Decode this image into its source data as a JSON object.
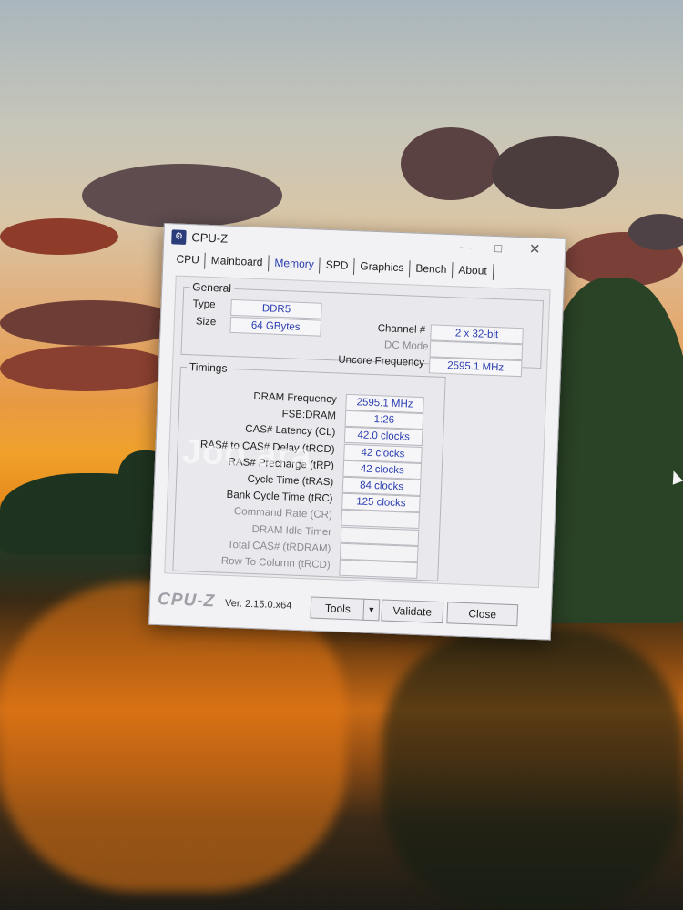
{
  "window": {
    "title": "CPU-Z",
    "tabs": [
      "CPU",
      "Mainboard",
      "Memory",
      "SPD",
      "Graphics",
      "Bench",
      "About"
    ],
    "active_tab": "Memory"
  },
  "general": {
    "legend": "General",
    "type_label": "Type",
    "type_value": "DDR5",
    "size_label": "Size",
    "size_value": "64 GBytes",
    "channel_label": "Channel #",
    "channel_value": "2 x 32-bit",
    "dc_mode_label": "DC Mode",
    "dc_mode_value": "",
    "uncore_label": "Uncore Frequency",
    "uncore_value": "2595.1 MHz"
  },
  "timings": {
    "legend": "Timings",
    "rows": [
      {
        "label": "DRAM Frequency",
        "value": "2595.1 MHz"
      },
      {
        "label": "FSB:DRAM",
        "value": "1:26"
      },
      {
        "label": "CAS# Latency (CL)",
        "value": "42.0 clocks"
      },
      {
        "label": "RAS# to CAS# Delay (tRCD)",
        "value": "42 clocks"
      },
      {
        "label": "RAS# Precharge (tRP)",
        "value": "42 clocks"
      },
      {
        "label": "Cycle Time (tRAS)",
        "value": "84 clocks"
      },
      {
        "label": "Bank Cycle Time (tRC)",
        "value": "125 clocks"
      },
      {
        "label": "Command Rate (CR)",
        "value": ""
      },
      {
        "label": "DRAM Idle Timer",
        "value": ""
      },
      {
        "label": "Total CAS# (tRDRAM)",
        "value": ""
      },
      {
        "label": "Row To Column (tRCD)",
        "value": ""
      }
    ]
  },
  "footer": {
    "brand": "CPU-Z",
    "version": "Ver. 2.15.0.x64",
    "tools_label": "Tools",
    "validate_label": "Validate",
    "close_label": "Close"
  },
  "watermark": "Joo        ara",
  "colors": {
    "value_text": "#2a3db0",
    "active_tab": "#2a3db0"
  },
  "icons": {
    "app": "cpu-z-app-icon",
    "minimize": "minimize-icon",
    "maximize": "maximize-icon",
    "close": "close-icon",
    "dropdown": "chevron-down-icon",
    "cursor": "mouse-pointer-icon"
  }
}
